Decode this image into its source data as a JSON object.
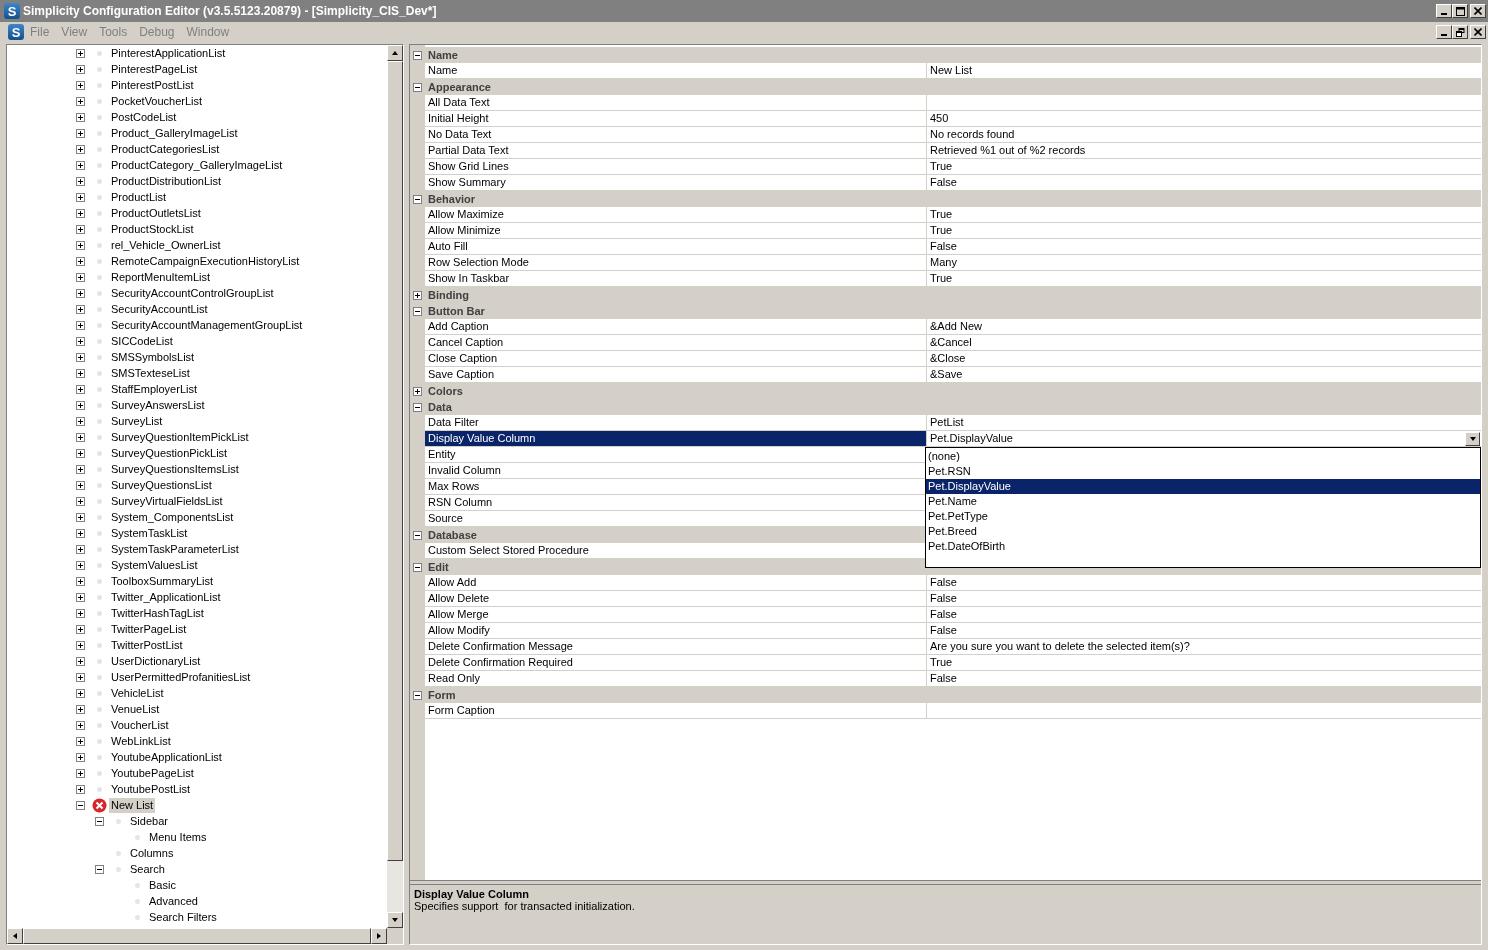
{
  "window": {
    "icon": "S",
    "title": "Simplicity Configuration Editor (v3.5.5123.20879) - [Simplicity_CIS_Dev*]"
  },
  "menu": {
    "icon": "S",
    "items": [
      {
        "label": "File",
        "disabled": true
      },
      {
        "label": "View",
        "disabled": true
      },
      {
        "label": "Tools",
        "disabled": true
      },
      {
        "label": "Debug",
        "disabled": true
      },
      {
        "label": "Window",
        "disabled": true
      }
    ]
  },
  "tree": {
    "items": [
      {
        "label": "PinterestApplicationList",
        "expanded": false,
        "selected": false,
        "error": false
      },
      {
        "label": "PinterestPageList",
        "expanded": false,
        "selected": false,
        "error": false
      },
      {
        "label": "PinterestPostList",
        "expanded": false,
        "selected": false,
        "error": false
      },
      {
        "label": "PocketVoucherList",
        "expanded": false,
        "selected": false,
        "error": false
      },
      {
        "label": "PostCodeList",
        "expanded": false,
        "selected": false,
        "error": false
      },
      {
        "label": "Product_GalleryImageList",
        "expanded": false,
        "selected": false,
        "error": false
      },
      {
        "label": "ProductCategoriesList",
        "expanded": false,
        "selected": false,
        "error": false
      },
      {
        "label": "ProductCategory_GalleryImageList",
        "expanded": false,
        "selected": false,
        "error": false
      },
      {
        "label": "ProductDistributionList",
        "expanded": false,
        "selected": false,
        "error": false
      },
      {
        "label": "ProductList",
        "expanded": false,
        "selected": false,
        "error": false
      },
      {
        "label": "ProductOutletsList",
        "expanded": false,
        "selected": false,
        "error": false
      },
      {
        "label": "ProductStockList",
        "expanded": false,
        "selected": false,
        "error": false
      },
      {
        "label": "rel_Vehicle_OwnerList",
        "expanded": false,
        "selected": false,
        "error": false
      },
      {
        "label": "RemoteCampaignExecutionHistoryList",
        "expanded": false,
        "selected": false,
        "error": false
      },
      {
        "label": "ReportMenuItemList",
        "expanded": false,
        "selected": false,
        "error": false
      },
      {
        "label": "SecurityAccountControlGroupList",
        "expanded": false,
        "selected": false,
        "error": false
      },
      {
        "label": "SecurityAccountList",
        "expanded": false,
        "selected": false,
        "error": false
      },
      {
        "label": "SecurityAccountManagementGroupList",
        "expanded": false,
        "selected": false,
        "error": false
      },
      {
        "label": "SICCodeList",
        "expanded": false,
        "selected": false,
        "error": false
      },
      {
        "label": "SMSSymbolsList",
        "expanded": false,
        "selected": false,
        "error": false
      },
      {
        "label": "SMSTexteseList",
        "expanded": false,
        "selected": false,
        "error": false
      },
      {
        "label": "StaffEmployerList",
        "expanded": false,
        "selected": false,
        "error": false
      },
      {
        "label": "SurveyAnswersList",
        "expanded": false,
        "selected": false,
        "error": false
      },
      {
        "label": "SurveyList",
        "expanded": false,
        "selected": false,
        "error": false
      },
      {
        "label": "SurveyQuestionItemPickList",
        "expanded": false,
        "selected": false,
        "error": false
      },
      {
        "label": "SurveyQuestionPickList",
        "expanded": false,
        "selected": false,
        "error": false
      },
      {
        "label": "SurveyQuestionsItemsList",
        "expanded": false,
        "selected": false,
        "error": false
      },
      {
        "label": "SurveyQuestionsList",
        "expanded": false,
        "selected": false,
        "error": false
      },
      {
        "label": "SurveyVirtualFieldsList",
        "expanded": false,
        "selected": false,
        "error": false
      },
      {
        "label": "System_ComponentsList",
        "expanded": false,
        "selected": false,
        "error": false
      },
      {
        "label": "SystemTaskList",
        "expanded": false,
        "selected": false,
        "error": false
      },
      {
        "label": "SystemTaskParameterList",
        "expanded": false,
        "selected": false,
        "error": false
      },
      {
        "label": "SystemValuesList",
        "expanded": false,
        "selected": false,
        "error": false
      },
      {
        "label": "ToolboxSummaryList",
        "expanded": false,
        "selected": false,
        "error": false
      },
      {
        "label": "Twitter_ApplicationList",
        "expanded": false,
        "selected": false,
        "error": false
      },
      {
        "label": "TwitterHashTagList",
        "expanded": false,
        "selected": false,
        "error": false
      },
      {
        "label": "TwitterPageList",
        "expanded": false,
        "selected": false,
        "error": false
      },
      {
        "label": "TwitterPostList",
        "expanded": false,
        "selected": false,
        "error": false
      },
      {
        "label": "UserDictionaryList",
        "expanded": false,
        "selected": false,
        "error": false
      },
      {
        "label": "UserPermittedProfanitiesList",
        "expanded": false,
        "selected": false,
        "error": false
      },
      {
        "label": "VehicleList",
        "expanded": false,
        "selected": false,
        "error": false
      },
      {
        "label": "VenueList",
        "expanded": false,
        "selected": false,
        "error": false
      },
      {
        "label": "VoucherList",
        "expanded": false,
        "selected": false,
        "error": false
      },
      {
        "label": "WebLinkList",
        "expanded": false,
        "selected": false,
        "error": false
      },
      {
        "label": "YoutubeApplicationList",
        "expanded": false,
        "selected": false,
        "error": false
      },
      {
        "label": "YoutubePageList",
        "expanded": false,
        "selected": false,
        "error": false
      },
      {
        "label": "YoutubePostList",
        "expanded": false,
        "selected": false,
        "error": false
      },
      {
        "label": "New List",
        "expanded": true,
        "selected": true,
        "error": true,
        "children": [
          {
            "label": "Sidebar",
            "expanded": true,
            "selected": false,
            "error": false,
            "children": [
              {
                "label": "Menu Items",
                "selected": false,
                "error": false
              }
            ]
          },
          {
            "label": "Columns",
            "selected": false,
            "error": false
          },
          {
            "label": "Search",
            "expanded": true,
            "selected": false,
            "error": false,
            "children": [
              {
                "label": "Basic",
                "selected": false,
                "error": false
              },
              {
                "label": "Advanced",
                "selected": false,
                "error": false
              },
              {
                "label": "Search Filters",
                "selected": false,
                "error": false
              }
            ]
          }
        ]
      }
    ]
  },
  "properties": {
    "categories": [
      {
        "name": "Name",
        "expanded": true,
        "properties": [
          {
            "name": "Name",
            "value": "New List",
            "selected": false
          }
        ]
      },
      {
        "name": "Appearance",
        "expanded": true,
        "properties": [
          {
            "name": "All Data Text",
            "selected": false
          },
          {
            "name": "Initial Height",
            "value": "450",
            "selected": false
          },
          {
            "name": "No Data Text",
            "value": "No records found",
            "selected": false
          },
          {
            "name": "Partial Data Text",
            "value": "Retrieved %1 out of %2 records",
            "selected": false
          },
          {
            "name": "Show Grid Lines",
            "value": "True",
            "selected": false
          },
          {
            "name": "Show Summary",
            "value": "False",
            "selected": false
          }
        ]
      },
      {
        "name": "Behavior",
        "expanded": true,
        "properties": [
          {
            "name": "Allow Maximize",
            "value": "True",
            "selected": false
          },
          {
            "name": "Allow Minimize",
            "value": "True",
            "selected": false
          },
          {
            "name": "Auto Fill",
            "value": "False",
            "selected": false
          },
          {
            "name": "Row Selection Mode",
            "value": "Many",
            "selected": false
          },
          {
            "name": "Show In Taskbar",
            "value": "True",
            "selected": false
          }
        ]
      },
      {
        "name": "Binding",
        "expanded": false
      },
      {
        "name": "Button Bar",
        "expanded": true,
        "properties": [
          {
            "name": "Add Caption",
            "value": "&Add New",
            "selected": false
          },
          {
            "name": "Cancel Caption",
            "value": "&Cancel",
            "selected": false
          },
          {
            "name": "Close Caption",
            "value": "&Close",
            "selected": false
          },
          {
            "name": "Save Caption",
            "value": "&Save",
            "selected": false
          }
        ]
      },
      {
        "name": "Colors",
        "expanded": false
      },
      {
        "name": "Data",
        "expanded": true,
        "properties": [
          {
            "name": "Data Filter",
            "value": "PetList",
            "selected": false
          },
          {
            "name": "Display Value Column",
            "value": "Pet.DisplayValue",
            "selected": true,
            "options": [
              {
                "label": "(none)",
                "selected": false
              },
              {
                "label": "Pet.RSN",
                "selected": false
              },
              {
                "label": "Pet.DisplayValue",
                "selected": true
              },
              {
                "label": "Pet.Name",
                "selected": false
              },
              {
                "label": "Pet.PetType",
                "selected": false
              },
              {
                "label": "Pet.Breed",
                "selected": false
              },
              {
                "label": "Pet.DateOfBirth",
                "selected": false
              }
            ]
          },
          {
            "name": "Entity",
            "selected": false
          },
          {
            "name": "Invalid Column",
            "selected": false
          },
          {
            "name": "Max Rows",
            "selected": false
          },
          {
            "name": "RSN Column",
            "selected": false
          },
          {
            "name": "Source",
            "selected": false
          }
        ]
      },
      {
        "name": "Database",
        "expanded": true,
        "properties": [
          {
            "name": "Custom Select Stored Procedure",
            "selected": false
          }
        ]
      },
      {
        "name": "Edit",
        "expanded": true,
        "properties": [
          {
            "name": "Allow Add",
            "value": "False",
            "selected": false
          },
          {
            "name": "Allow Delete",
            "value": "False",
            "selected": false
          },
          {
            "name": "Allow Merge",
            "value": "False",
            "selected": false
          },
          {
            "name": "Allow Modify",
            "value": "False",
            "selected": false
          },
          {
            "name": "Delete Confirmation Message",
            "value": "Are you sure you want to delete the selected item(s)?",
            "selected": false
          },
          {
            "name": "Delete Confirmation Required",
            "value": "True",
            "selected": false
          },
          {
            "name": "Read Only",
            "value": "False",
            "selected": false
          }
        ]
      },
      {
        "name": "Form",
        "expanded": true,
        "properties": [
          {
            "name": "Form Caption",
            "selected": false
          }
        ]
      }
    ]
  },
  "description": {
    "title": "Display Value Column",
    "text": "Specifies support  for transacted initialization."
  }
}
